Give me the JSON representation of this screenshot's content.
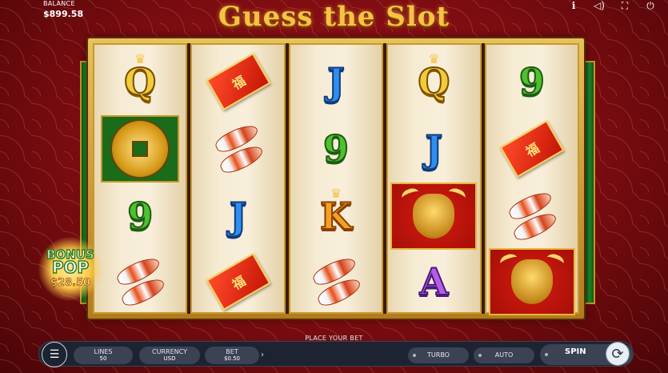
{
  "header": {
    "balance_label": "BALANCE",
    "balance_value": "$899.58",
    "title": "Guess the Slot",
    "icons": [
      "info-icon",
      "sound-icon",
      "fullscreen-icon",
      "power-icon"
    ]
  },
  "reels": [
    [
      "Q",
      "coin",
      "9",
      "koi"
    ],
    [
      "envelope",
      "koi",
      "J",
      "envelope"
    ],
    [
      "J",
      "9",
      "K",
      "koi"
    ],
    [
      "Q",
      "J",
      "bull",
      "A"
    ],
    [
      "9",
      "envelope",
      "koi",
      "bull"
    ]
  ],
  "symbols": {
    "Q": "Q",
    "J": "J",
    "K": "K",
    "A": "A",
    "nine": "9",
    "envelope_text": "福"
  },
  "bonus": {
    "line1": "BONUS",
    "line2": "POP",
    "amount": "$28.50"
  },
  "footer": {
    "place_bet": "PLACE YOUR BET",
    "lines_label": "LINES",
    "lines_value": "50",
    "currency_label": "CURRENCY",
    "currency_value": "USD",
    "bet_label": "BET",
    "bet_value": "$0.50",
    "turbo": "TURBO",
    "auto": "AUTO",
    "spin": "SPIN"
  },
  "colors": {
    "accent": "#f6c342",
    "background": "#7a0c10",
    "bar": "#1d2330"
  }
}
